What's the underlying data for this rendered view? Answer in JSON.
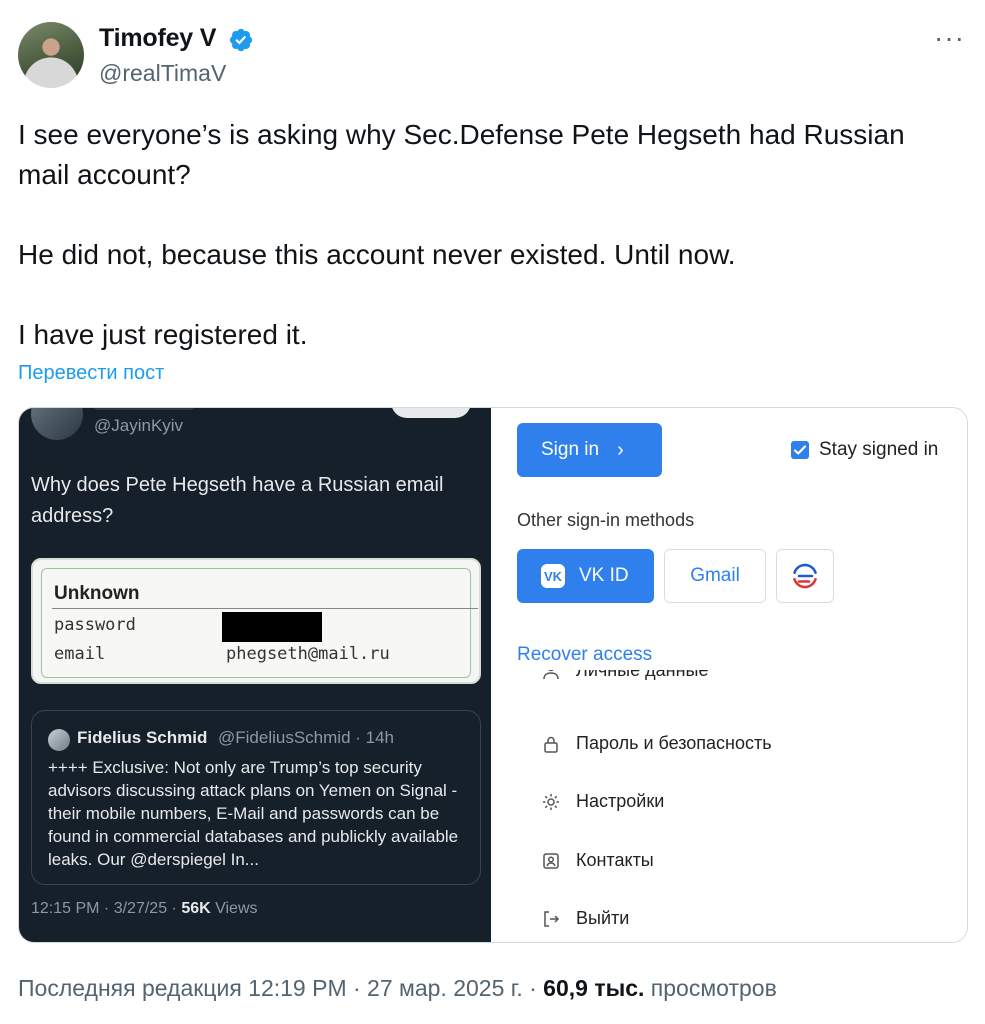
{
  "author": {
    "name": "Timofey V",
    "handle": "@realTimaV"
  },
  "tweet": {
    "paragraphs": [
      "I see everyone’s is asking why Sec.Defense Pete Hegseth had Russian mail account?",
      "He did not, because this account never existed. Until now.",
      "I have just registered it."
    ],
    "translate_label": "Перевести пост"
  },
  "left_screenshot": {
    "handle": "@JayinKyiv",
    "question": "Why does Pete Hegseth have a Russian email address?",
    "leak": {
      "title": "Unknown",
      "password_key": "password",
      "email_key": "email",
      "email_value": "phegseth@mail.ru"
    },
    "quote": {
      "name": "Fidelius Schmid",
      "meta": "@FideliusSchmid · 14h",
      "body": "++++ Exclusive: Not only are Trump’s top security advisors discussing attack plans on Yemen on Signal - their mobile numbers, E-Mail and passwords can be found in commercial databases and publickly available leaks. Our @derspiegel In..."
    },
    "footer_time": "12:15 PM · 3/27/25 · ",
    "footer_views_count": "56K",
    "footer_views_label": " Views"
  },
  "right_screenshot": {
    "sign_in": "Sign in",
    "stay_signed_in": "Stay signed in",
    "stay_checked": true,
    "other_methods": "Other sign-in methods",
    "vk_id": "VK ID",
    "gmail": "Gmail",
    "recover": "Recover access",
    "menu": [
      {
        "icon": "user-icon",
        "label": "Личные данные"
      },
      {
        "icon": "lock-icon",
        "label": "Пароль и безопасность"
      },
      {
        "icon": "gear-icon",
        "label": "Настройки"
      },
      {
        "icon": "contacts-icon",
        "label": "Контакты"
      },
      {
        "icon": "logout-icon",
        "label": "Выйти"
      }
    ],
    "accent_color": "#2f80ed"
  },
  "footer": {
    "edited": "Последняя редакция 12:19 PM · 27 мар. 2025 г. · ",
    "views_count": "60,9 тыс.",
    "views_label": " просмотров"
  },
  "colors": {
    "verified": "#1d9bf0",
    "link": "#1d9bf0",
    "dark_bg": "#15202b"
  }
}
